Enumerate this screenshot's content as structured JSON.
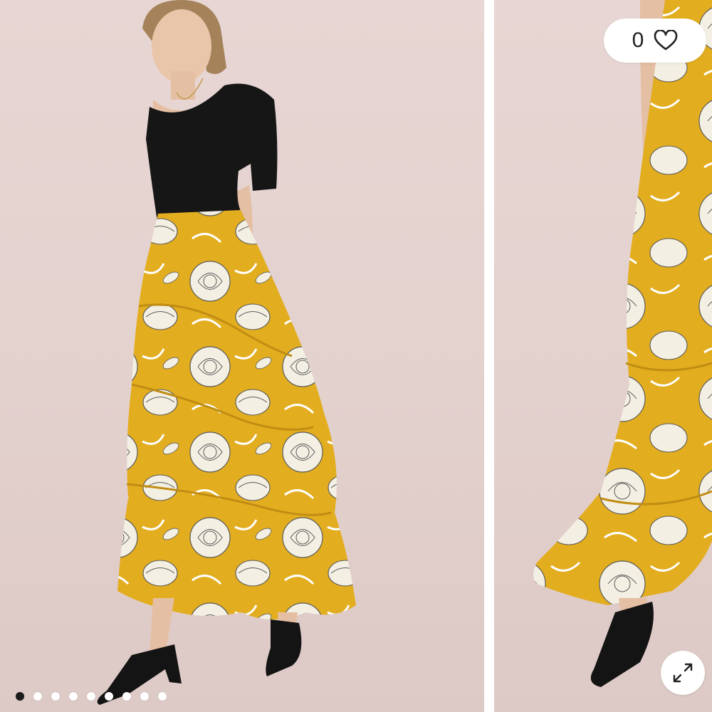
{
  "carousel": {
    "slides": [
      {
        "name": "model-full-length-photo"
      },
      {
        "name": "model-skirt-detail-photo"
      }
    ],
    "dot_count": 9,
    "active_index": 0
  },
  "like": {
    "count": "0",
    "icon": "heart-outline-icon"
  },
  "expand": {
    "icon": "expand-arrows-icon"
  },
  "colors": {
    "backdrop": "#e5d3d0",
    "skirt_yellow": "#e2ad1f",
    "flower_cream": "#f3efe3",
    "top_black": "#161616",
    "active_dot": "#1b1b1b",
    "inactive_dot": "#ffffff"
  }
}
